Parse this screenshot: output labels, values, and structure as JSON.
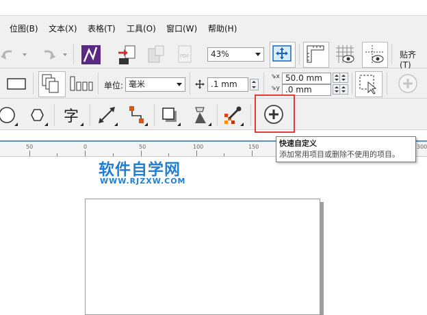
{
  "menu": [
    "位图(B)",
    "文本(X)",
    "表格(T)",
    "工具(O)",
    "窗口(W)",
    "帮助(H)"
  ],
  "toolbar": {
    "zoom_value": "43%",
    "snap_label": "贴齐(T)"
  },
  "property_bar": {
    "units_label": "单位:",
    "units_value": "毫米",
    "nudge_value": ".1 mm",
    "dup_x_value": "50.0 mm",
    "dup_y_value": ".0 mm"
  },
  "ruler": {
    "labels": [
      "50",
      "0",
      "50",
      "100",
      "150",
      "300"
    ]
  },
  "tooltip": {
    "title": "快速自定义",
    "description": "添加常用项目或删除不使用的项目。"
  },
  "watermark": {
    "title": "软件自学网",
    "url": "WWW.RJZXW.COM"
  },
  "colors": {
    "accent": "#1e7fd6",
    "highlight_box": "#e53935"
  }
}
